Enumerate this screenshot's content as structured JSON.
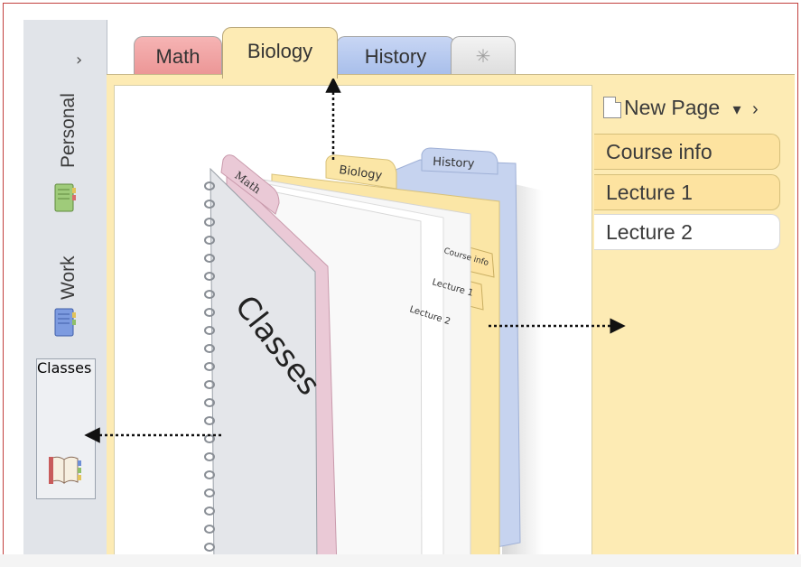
{
  "nav": {
    "expand_glyph": "›",
    "notebooks": [
      {
        "label": "Personal",
        "icon": "green-notebook-icon",
        "color": "#8fbf6a"
      },
      {
        "label": "Work",
        "icon": "blue-notebook-icon",
        "color": "#6e8fd6"
      },
      {
        "label": "Classes",
        "icon": "open-book-icon",
        "color": "#c85b5b"
      }
    ]
  },
  "section_tabs": [
    {
      "label": "Math",
      "color": "#eb9494"
    },
    {
      "label": "Biology",
      "color": "#fdebb4",
      "selected": true
    },
    {
      "label": "History",
      "color": "#a6bdea"
    },
    {
      "label": "✳",
      "icon": "new-section-icon"
    }
  ],
  "page_list": {
    "new_page_label": "New Page",
    "dropdown_glyph": "▾",
    "collapse_glyph": "›",
    "pages": [
      {
        "label": "Course info"
      },
      {
        "label": "Lecture 1"
      },
      {
        "label": "Lecture 2"
      }
    ]
  },
  "illustration": {
    "cover_title": "Classes",
    "tab_labels": [
      "Math",
      "Biology",
      "History"
    ],
    "page_labels": [
      "Course info",
      "Lecture 1",
      "Lecture 2"
    ]
  },
  "colors": {
    "section_yellow": "#fdebb4",
    "math_pink": "#eb9494",
    "history_blue": "#a6bdea",
    "frame_red": "#c2403f"
  }
}
